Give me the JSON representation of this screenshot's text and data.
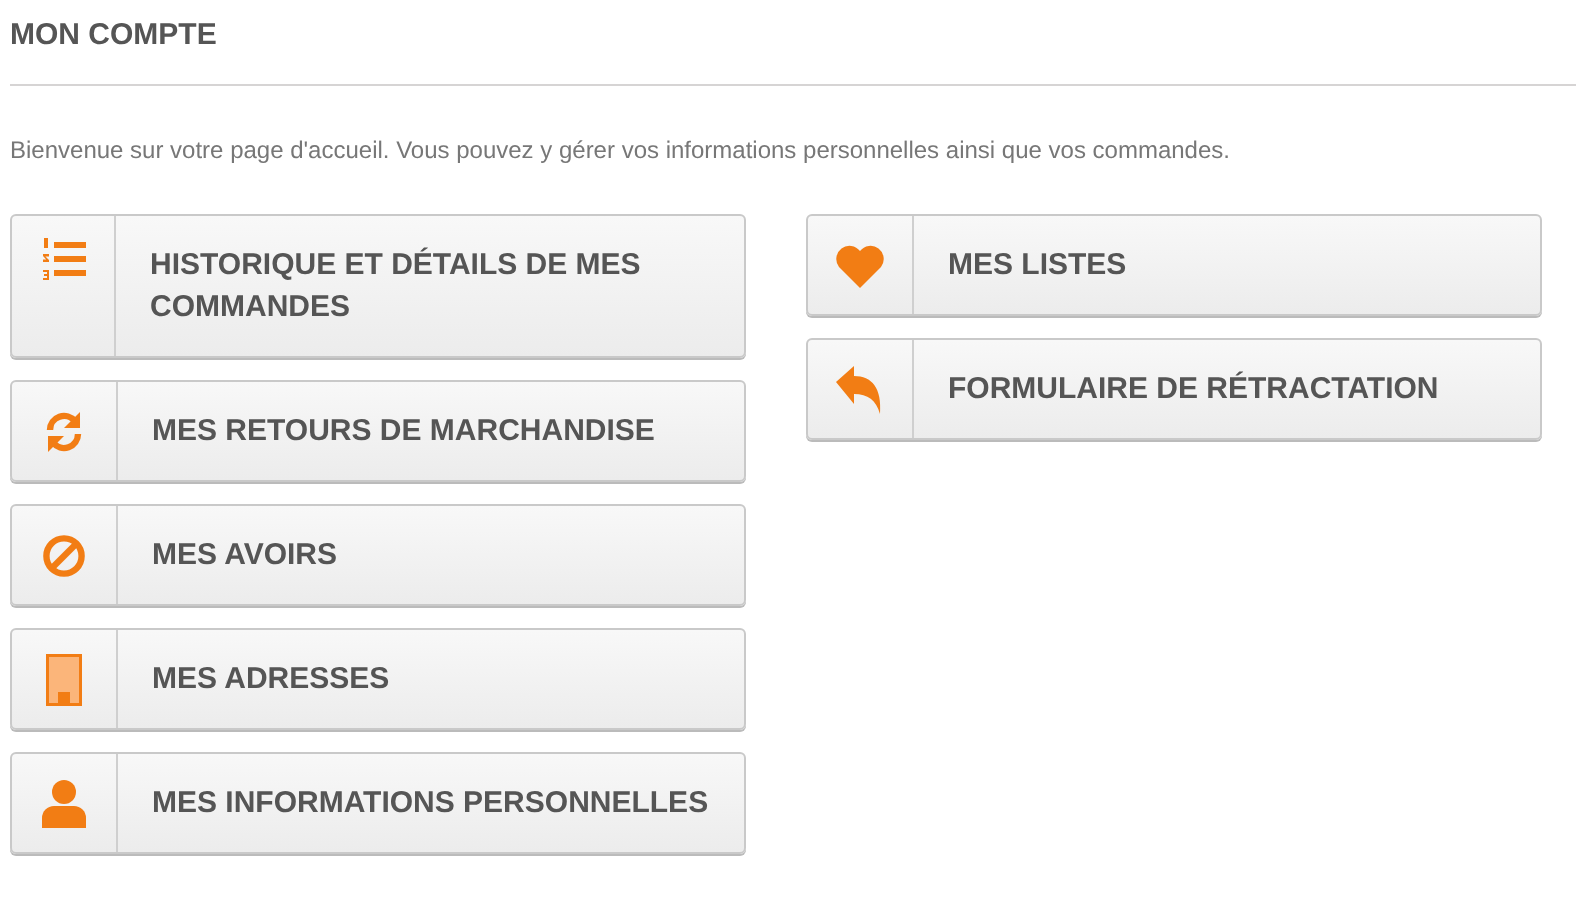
{
  "page_title": "MON COMPTE",
  "intro": "Bienvenue sur votre page d'accueil. Vous pouvez y gérer vos informations personnelles ainsi que vos commandes.",
  "left_links": [
    {
      "label": "HISTORIQUE ET DÉTAILS DE MES COMMANDES",
      "kind": "orders"
    },
    {
      "label": "MES RETOURS DE MARCHANDISE",
      "kind": "returns"
    },
    {
      "label": "MES AVOIRS",
      "kind": "credits"
    },
    {
      "label": "MES ADRESSES",
      "kind": "addresses"
    },
    {
      "label": "MES INFORMATIONS PERSONNELLES",
      "kind": "profile"
    }
  ],
  "right_links": [
    {
      "label": "MES LISTES",
      "kind": "wishlist"
    },
    {
      "label": "FORMULAIRE DE RÉTRACTATION",
      "kind": "withdrawal"
    }
  ]
}
